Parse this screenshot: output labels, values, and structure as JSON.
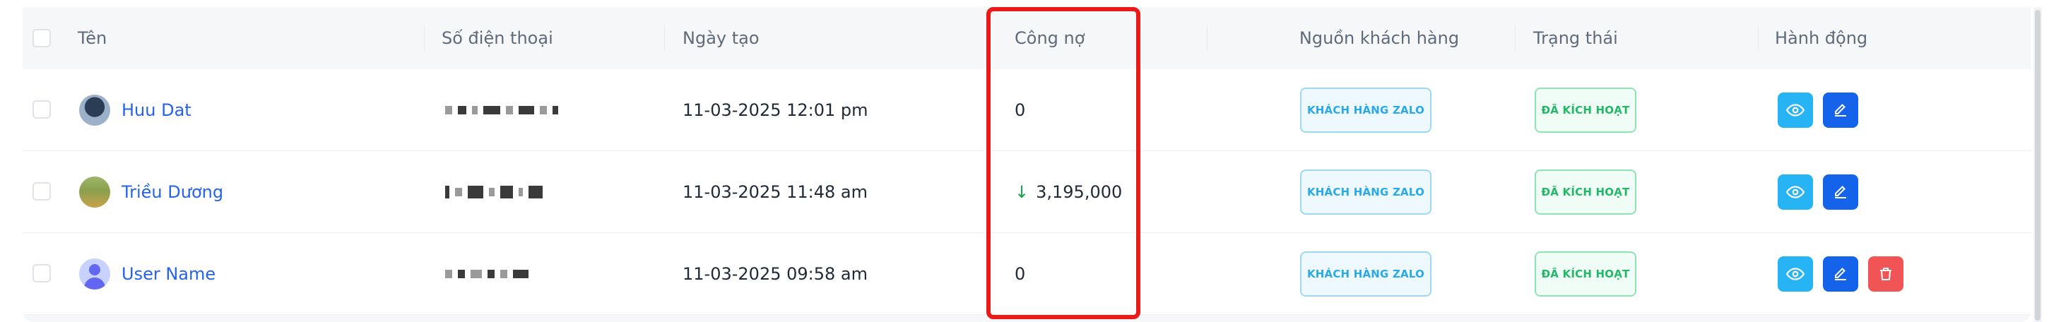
{
  "table": {
    "columns": {
      "name": "Tên",
      "phone": "Số điện thoại",
      "created": "Ngày tạo",
      "debt": "Công nợ",
      "source": "Nguồn khách hàng",
      "status": "Trạng thái",
      "actions": "Hành động"
    },
    "rows": [
      {
        "name": "Huu Dat",
        "created": "11-03-2025 12:01 pm",
        "debt": "0",
        "source": "KHÁCH HÀNG ZALO",
        "status": "ĐÃ KÍCH HOẠT"
      },
      {
        "name": "Triều Dương",
        "created": "11-03-2025 11:48 am",
        "debt": "3,195,000",
        "debt_arrow": "↓",
        "source": "KHÁCH HÀNG ZALO",
        "status": "ĐÃ KÍCH HOẠT"
      },
      {
        "name": "User Name",
        "created": "11-03-2025 09:58 am",
        "debt": "0",
        "source": "KHÁCH HÀNG ZALO",
        "status": "ĐÃ KÍCH HOẠT"
      }
    ]
  },
  "icons": {
    "view": "eye-icon",
    "edit": "pencil-icon",
    "delete": "trash-icon",
    "debt_decrease": "arrow-down-icon"
  },
  "colors": {
    "highlight_box": "#e81a1a",
    "link": "#2563eb",
    "source_badge": "#29a9e8",
    "status_badge": "#22b866",
    "view_button": "#26b4f4",
    "edit_button": "#1563ea",
    "delete_button": "#f05454"
  }
}
